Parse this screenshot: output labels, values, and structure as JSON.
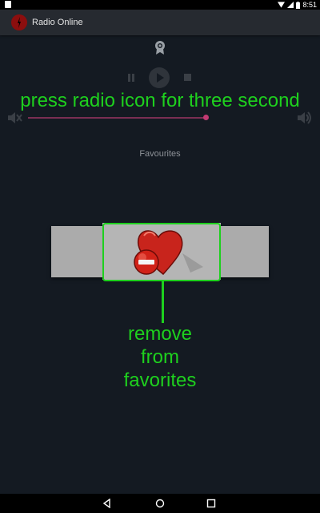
{
  "status_bar": {
    "time": "8:51"
  },
  "app_bar": {
    "title": "Radio Online"
  },
  "player": {
    "volume_fraction": 0.75
  },
  "favourites": {
    "label": "Favourites"
  },
  "annotations": {
    "top_text": "press radio icon for three second",
    "bottom_lines": [
      "remove",
      "from",
      "favorites"
    ]
  },
  "colors": {
    "annotation": "#1ed01e",
    "volume_accent": "#c23a72",
    "background": "#141a22"
  },
  "icons": [
    "award-icon",
    "pause-icon",
    "play-icon",
    "stop-icon",
    "mute-icon",
    "volume-icon",
    "heart-remove-icon",
    "back-icon",
    "home-icon",
    "recent-apps-icon"
  ]
}
